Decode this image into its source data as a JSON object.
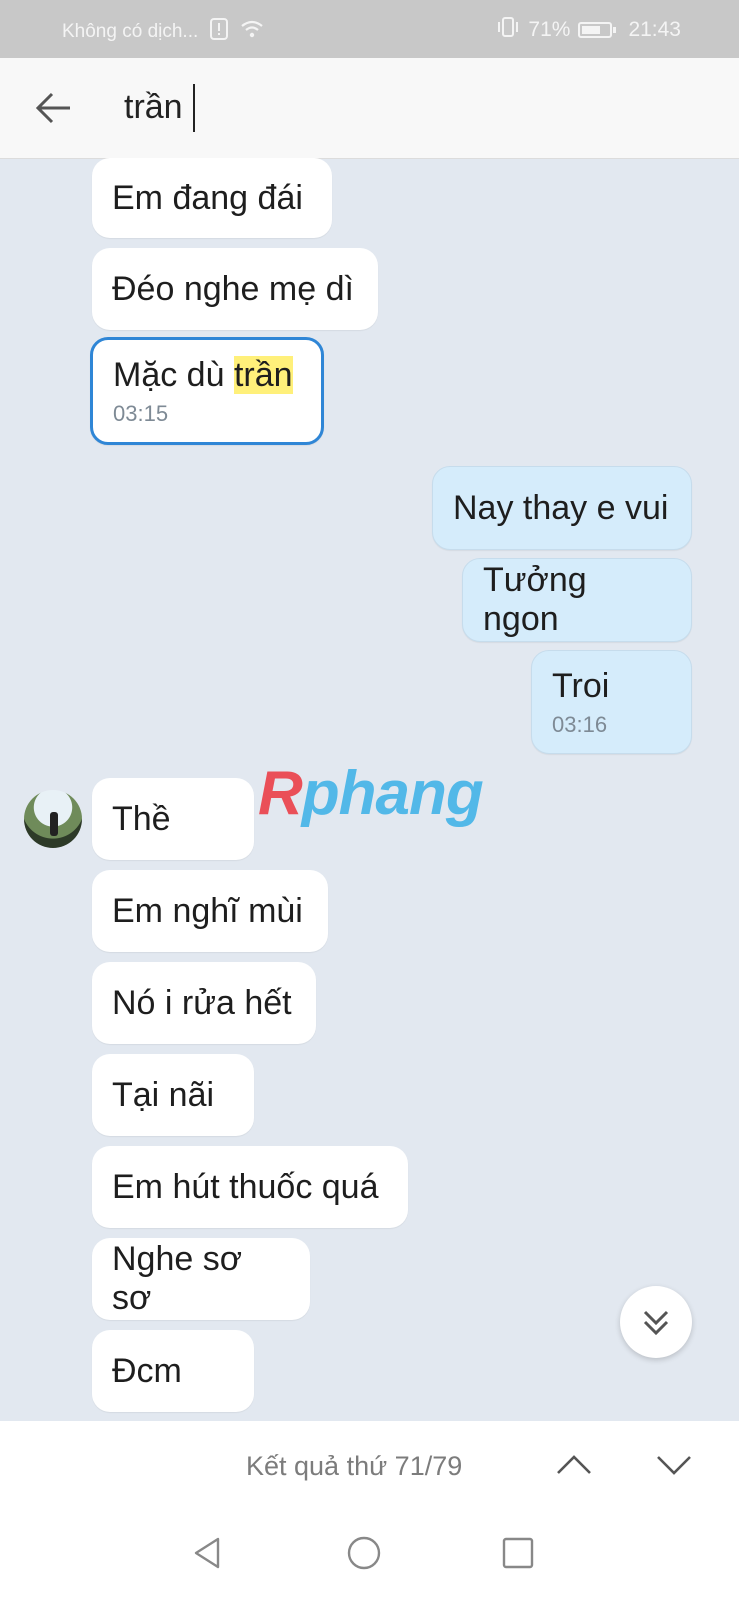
{
  "status_bar": {
    "carrier": "Không có dịch...",
    "battery_percent": "71%",
    "battery_level": 0.71,
    "time": "21:43"
  },
  "search": {
    "query": "trần"
  },
  "messages": [
    {
      "text": "Em đang đái",
      "direction": "in"
    },
    {
      "text": "Đéo nghe mẹ dì",
      "direction": "in"
    },
    {
      "text_before": "Mặc dù ",
      "text_match": "trần",
      "time": "03:15",
      "direction": "in",
      "focused": true
    },
    {
      "text": "Nay thay e vui",
      "direction": "out"
    },
    {
      "text": "Tưởng ngon",
      "direction": "out"
    },
    {
      "text": "Troi",
      "time": "03:16",
      "direction": "out"
    },
    {
      "text": "Thề",
      "direction": "in"
    },
    {
      "text": "Em nghĩ mùi",
      "direction": "in"
    },
    {
      "text": "Nó i rửa hết",
      "direction": "in"
    },
    {
      "text": "Tại nãi",
      "direction": "in"
    },
    {
      "text": "Em hút thuốc quá",
      "direction": "in"
    },
    {
      "text": "Nghe sơ sơ",
      "direction": "in"
    },
    {
      "text": "Đcm",
      "direction": "in"
    }
  ],
  "watermark": {
    "first_letter": "R",
    "rest": "phang"
  },
  "result_bar": {
    "label": "Kết quả thứ 71/79"
  },
  "colors": {
    "accent": "#2f86d6",
    "highlight": "#fff07a",
    "outgoing_bubble": "#d5ecfb",
    "background": "#e2e8f0"
  }
}
